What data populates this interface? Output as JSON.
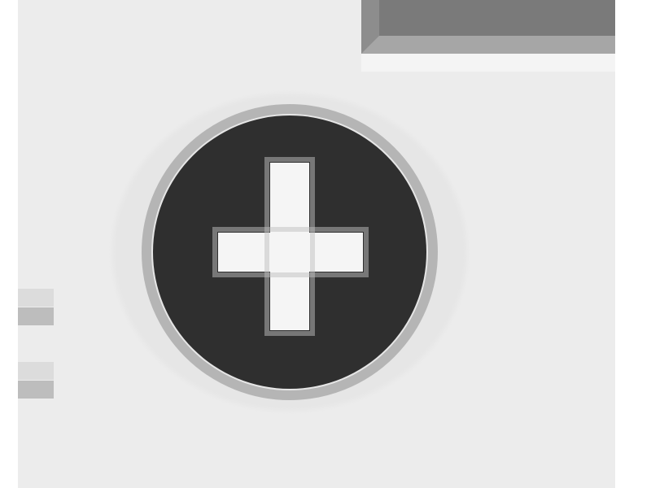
{
  "screen": {
    "description_label": "",
    "zoom_level": "",
    "background_color": "#ececec"
  },
  "toolbar": {
    "bar_color": "#7a7a7a"
  },
  "add_control": {
    "icon": "plus-circle-icon",
    "fill_color": "#2f2f2f",
    "glyph_color": "#f5f5f5"
  }
}
